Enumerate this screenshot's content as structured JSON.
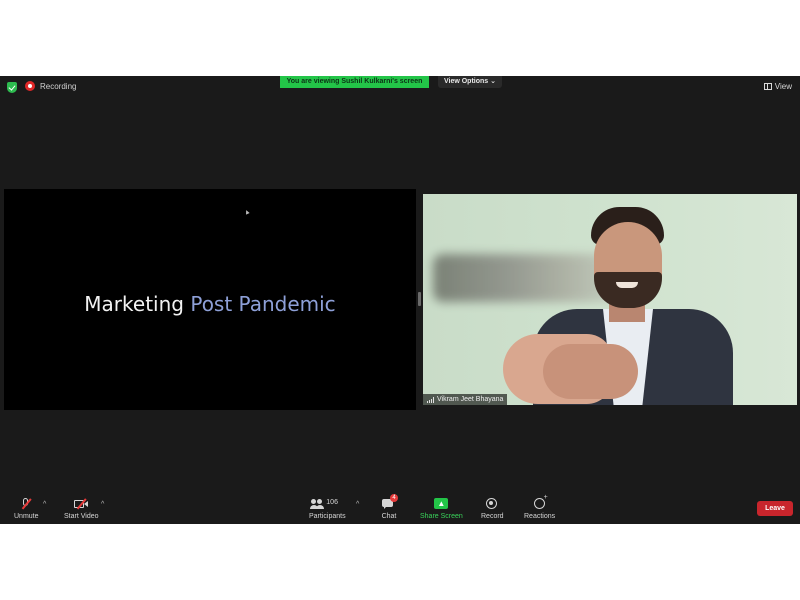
{
  "topbar": {
    "recording_label": "Recording",
    "viewing_banner": "You are viewing Sushil Kulkarni's screen",
    "view_options_label": "View Options",
    "view_label": "View"
  },
  "shared_screen": {
    "title_part1": "Marketing",
    "title_part2": "Post Pandemic"
  },
  "video": {
    "participant_name": "Vikram Jeet Bhayana"
  },
  "toolbar": {
    "unmute_label": "Unmute",
    "start_video_label": "Start Video",
    "participants_label": "Participants",
    "participants_count": "106",
    "chat_label": "Chat",
    "chat_badge": "4",
    "share_screen_label": "Share Screen",
    "record_label": "Record",
    "reactions_label": "Reactions",
    "leave_label": "Leave"
  },
  "colors": {
    "window_bg": "#1a1a1a",
    "share_green": "#23c548",
    "leave_red": "#c8252c",
    "slide_accent": "#8ea0d8"
  },
  "icons": [
    "shield-check-icon",
    "record-icon",
    "grid-view-icon",
    "mic-muted-icon",
    "video-off-icon",
    "participants-icon",
    "chat-icon",
    "share-screen-icon",
    "record-button-icon",
    "reactions-icon",
    "signal-icon",
    "chevron-down-icon"
  ]
}
